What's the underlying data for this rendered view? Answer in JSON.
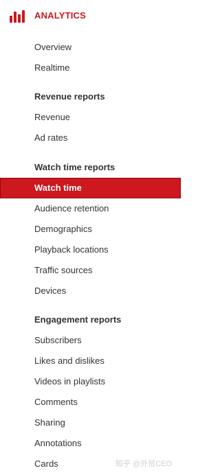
{
  "header": {
    "title": "ANALYTICS",
    "icon": "bar-chart-icon",
    "accent_color": "#cc181e"
  },
  "sections": [
    {
      "heading": "",
      "items": [
        {
          "label": "Overview"
        },
        {
          "label": "Realtime"
        }
      ]
    },
    {
      "heading": "Revenue reports",
      "items": [
        {
          "label": "Revenue"
        },
        {
          "label": "Ad rates"
        }
      ]
    },
    {
      "heading": "Watch time reports",
      "items": [
        {
          "label": "Watch time",
          "active": true
        },
        {
          "label": "Audience retention"
        },
        {
          "label": "Demographics"
        },
        {
          "label": "Playback locations"
        },
        {
          "label": "Traffic sources"
        },
        {
          "label": "Devices"
        }
      ]
    },
    {
      "heading": "Engagement reports",
      "items": [
        {
          "label": "Subscribers"
        },
        {
          "label": "Likes and dislikes"
        },
        {
          "label": "Videos in playlists"
        },
        {
          "label": "Comments"
        },
        {
          "label": "Sharing"
        },
        {
          "label": "Annotations"
        },
        {
          "label": "Cards"
        }
      ]
    }
  ],
  "watermark": "知乎 @外贸CEO"
}
